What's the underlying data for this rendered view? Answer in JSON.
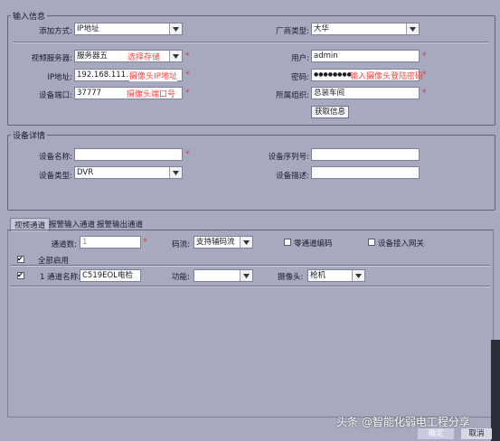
{
  "input_info": {
    "title": "输入信息",
    "add_method": {
      "label": "添加方式:",
      "value": "IP地址"
    },
    "vendor_type": {
      "label": "厂商类型:",
      "value": "大华"
    },
    "video_server": {
      "label": "视频服务器:",
      "value": "服务器五",
      "annotation": "选择存储"
    },
    "user": {
      "label": "用户:",
      "value": "admin"
    },
    "ip": {
      "label": "IP地址:",
      "value": "192.168.111.107",
      "annotation": "摄像头IP地址"
    },
    "password": {
      "label": "密码:",
      "value": "●●●●●●●●",
      "annotation": "输入摄像头登陆密码"
    },
    "port": {
      "label": "设备端口:",
      "value": "37777",
      "annotation": "摄像头端口号"
    },
    "org": {
      "label": "所属组织:",
      "value": "总装车间"
    },
    "fetch_button": "获取信息",
    "required_mark": "*"
  },
  "device_detail": {
    "title": "设备详情",
    "name": {
      "label": "设备名称:",
      "value": ""
    },
    "serial": {
      "label": "设备序列号:",
      "value": ""
    },
    "type": {
      "label": "设备类型:",
      "value": "DVR"
    },
    "desc": {
      "label": "设备描述:",
      "value": ""
    }
  },
  "tabs": [
    "视频通道",
    "报警输入通道",
    "报警输出通道"
  ],
  "channel": {
    "count": {
      "label": "通道数:",
      "value": "1"
    },
    "stream": {
      "label": "码流:",
      "value": "支持辅码流"
    },
    "zero_channel": {
      "label": "零通道编码",
      "checked": false
    },
    "access_gateway": {
      "label": "设备接入网关",
      "checked": false
    },
    "enable_all": {
      "label": "全部启用",
      "checked": true
    },
    "row": {
      "checked": true,
      "index_label": "1 通道名称:",
      "name": "C519EOL电检",
      "function_label": "功能:",
      "function_value": "",
      "camera_label": "摄像头:",
      "camera_value": "枪机"
    }
  },
  "footer": {
    "ok": "确定",
    "cancel": "取消",
    "watermark": "头条 @智能化弱电工程分享"
  }
}
